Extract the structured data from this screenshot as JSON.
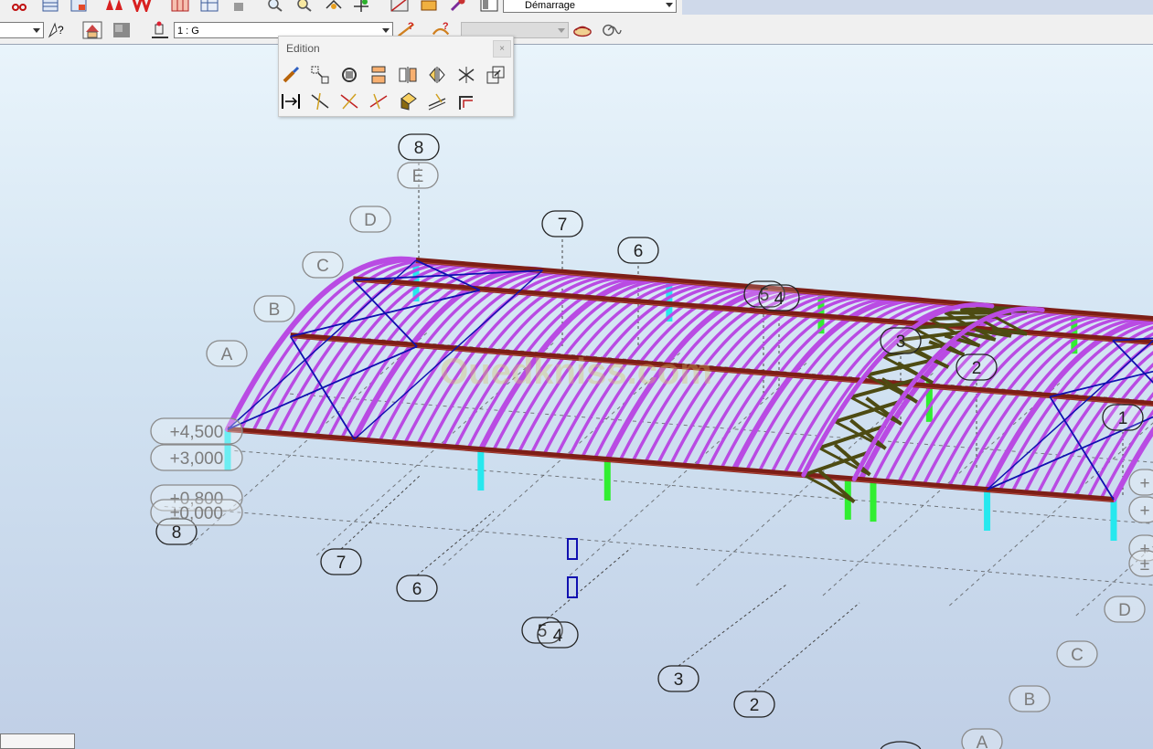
{
  "toolbar": {
    "view_combo": "Démarrage",
    "scale_combo": "1 : G",
    "left_combo": "",
    "disabled_combo": ""
  },
  "palette": {
    "title": "Edition",
    "close": "×"
  },
  "watermark": "Ouedkniss.com",
  "levels": [
    "+4,500",
    "+3,000",
    "+0,800",
    "±0,000"
  ],
  "right_levels": [
    "+",
    "+",
    "+",
    "±"
  ],
  "grid_numbers_top": [
    "8",
    "7",
    "6",
    "5",
    "4",
    "3",
    "2",
    "1"
  ],
  "grid_numbers_bottom": [
    "8",
    "7",
    "6",
    "5",
    "4",
    "3",
    "2"
  ],
  "grid_letters_left": [
    "A",
    "B",
    "C",
    "D",
    "E"
  ],
  "grid_letters_right": [
    "D",
    "C",
    "B",
    "A"
  ],
  "colors": {
    "arches": "#b94be3",
    "beams": "#7d1e16",
    "bracing": "#1010b0",
    "columns_cyan": "#26e8ee",
    "columns_green": "#31ee31",
    "truss": "#4d4b12",
    "gridline": "#4a4a4a"
  }
}
